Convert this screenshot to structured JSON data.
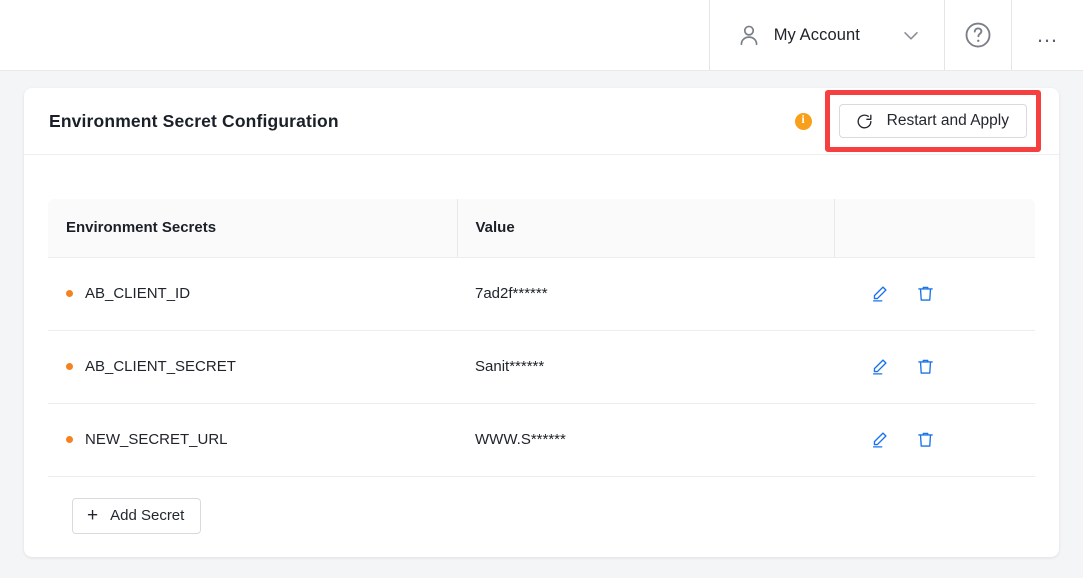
{
  "topbar": {
    "account_label": "My Account",
    "person_icon": "person-icon",
    "chevron_icon": "chevron-down-icon",
    "help_icon": "question-circle-icon",
    "more_icon": "ellipsis-icon"
  },
  "card": {
    "title": "Environment Secret Configuration",
    "info_badge": "i",
    "restart_label": "Restart and Apply",
    "refresh_icon": "refresh-icon",
    "highlight_color": "#f6403f",
    "accent_color": "#f5821f",
    "action_color": "#1a73e8"
  },
  "table": {
    "columns": [
      "Environment Secrets",
      "Value",
      ""
    ],
    "rows": [
      {
        "name": "AB_CLIENT_ID",
        "value": "7ad2f******",
        "edit_icon": "pencil-icon",
        "delete_icon": "trash-icon"
      },
      {
        "name": "AB_CLIENT_SECRET",
        "value": "Sanit******",
        "edit_icon": "pencil-icon",
        "delete_icon": "trash-icon"
      },
      {
        "name": "NEW_SECRET_URL",
        "value": "WWW.S******",
        "edit_icon": "pencil-icon",
        "delete_icon": "trash-icon"
      }
    ]
  },
  "footer": {
    "add_label": "Add Secret",
    "plus_icon": "plus-icon"
  }
}
